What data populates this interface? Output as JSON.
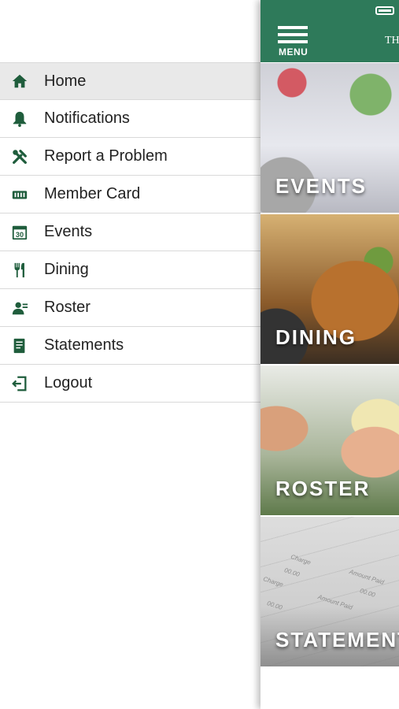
{
  "drawer": {
    "items": [
      {
        "label": "Home",
        "icon": "home-icon",
        "active": true
      },
      {
        "label": "Notifications",
        "icon": "bell-icon"
      },
      {
        "label": "Report a Problem",
        "icon": "tools-icon"
      },
      {
        "label": "Member Card",
        "icon": "card-icon"
      },
      {
        "label": "Events",
        "icon": "calendar-icon",
        "calendar_day": "30"
      },
      {
        "label": "Dining",
        "icon": "fork-knife-icon"
      },
      {
        "label": "Roster",
        "icon": "person-icon"
      },
      {
        "label": "Statements",
        "icon": "document-icon"
      },
      {
        "label": "Logout",
        "icon": "logout-icon"
      }
    ]
  },
  "header": {
    "menu_label": "MENU",
    "title_fragment": "TH"
  },
  "tiles": [
    {
      "label": "EVENTS"
    },
    {
      "label": "DINING"
    },
    {
      "label": "ROSTER"
    },
    {
      "label": "STATEMENTS",
      "doc_text": [
        "Charge",
        "Amount Paid",
        "00.00",
        "Charge",
        "00.00",
        "Amount Paid",
        "00.00"
      ]
    }
  ],
  "colors": {
    "brand_green": "#2e7a5a",
    "icon_green": "#1f5d3c",
    "active_row": "#e9e9e9"
  }
}
